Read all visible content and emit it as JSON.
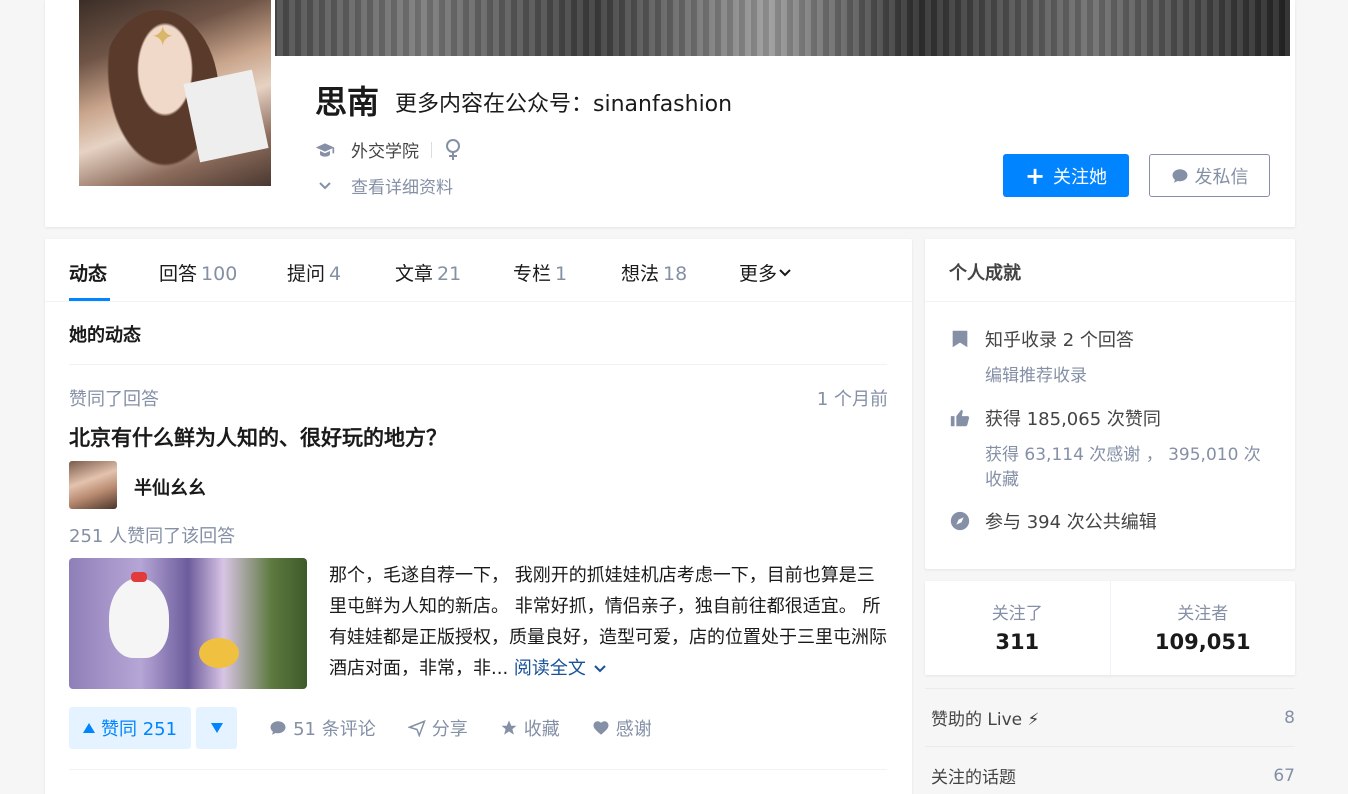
{
  "profile": {
    "name": "思南",
    "headline": "更多内容在公众号：sinanfashion",
    "school": "外交学院",
    "gender_icon": "female-symbol-icon",
    "more_info_label": "查看详细资料",
    "follow_label": "关注她",
    "message_label": "发私信"
  },
  "tabs": [
    {
      "label": "动态",
      "count": ""
    },
    {
      "label": "回答",
      "count": "100"
    },
    {
      "label": "提问",
      "count": "4"
    },
    {
      "label": "文章",
      "count": "21"
    },
    {
      "label": "专栏",
      "count": "1"
    },
    {
      "label": "想法",
      "count": "18"
    },
    {
      "label": "更多",
      "count": ""
    }
  ],
  "feed": {
    "section_title": "她的动态",
    "item": {
      "action": "赞同了回答",
      "time": "1 个月前",
      "question": "北京有什么鲜为人知的、很好玩的地方？",
      "author": "半仙幺幺",
      "vote_summary": "251 人赞同了该回答",
      "excerpt": "那个，毛遂自荐一下， 我刚开的抓娃娃机店考虑一下，目前也算是三里屯鲜为人知的新店。 非常好抓，情侣亲子，独自前往都很适宜。 所有娃娃都是正版授权，质量良好，造型可爱，店的位置处于三里屯洲际酒店对面，非常，非...",
      "read_more": "阅读全文",
      "upvote_label": "赞同 251",
      "comments_label": "51 条评论",
      "share_label": "分享",
      "favorite_label": "收藏",
      "thanks_label": "感谢"
    }
  },
  "achievements": {
    "title": "个人成就",
    "collect": "知乎收录 2 个回答",
    "collect_edit": "编辑推荐收录",
    "upvotes": "获得 185,065 次赞同",
    "thanks_favs": "获得 63,114 次感谢 ， 395,010 次收藏",
    "edits": "参与 394 次公共编辑"
  },
  "follow_stats": {
    "following_label": "关注了",
    "following": "311",
    "followers_label": "关注者",
    "followers": "109,051"
  },
  "side_list": [
    {
      "label": "赞助的 Live ⚡",
      "count": "8"
    },
    {
      "label": "关注的话题",
      "count": "67"
    }
  ],
  "colors": {
    "accent": "#0084ff",
    "muted": "#8590a6",
    "link": "#175199"
  }
}
